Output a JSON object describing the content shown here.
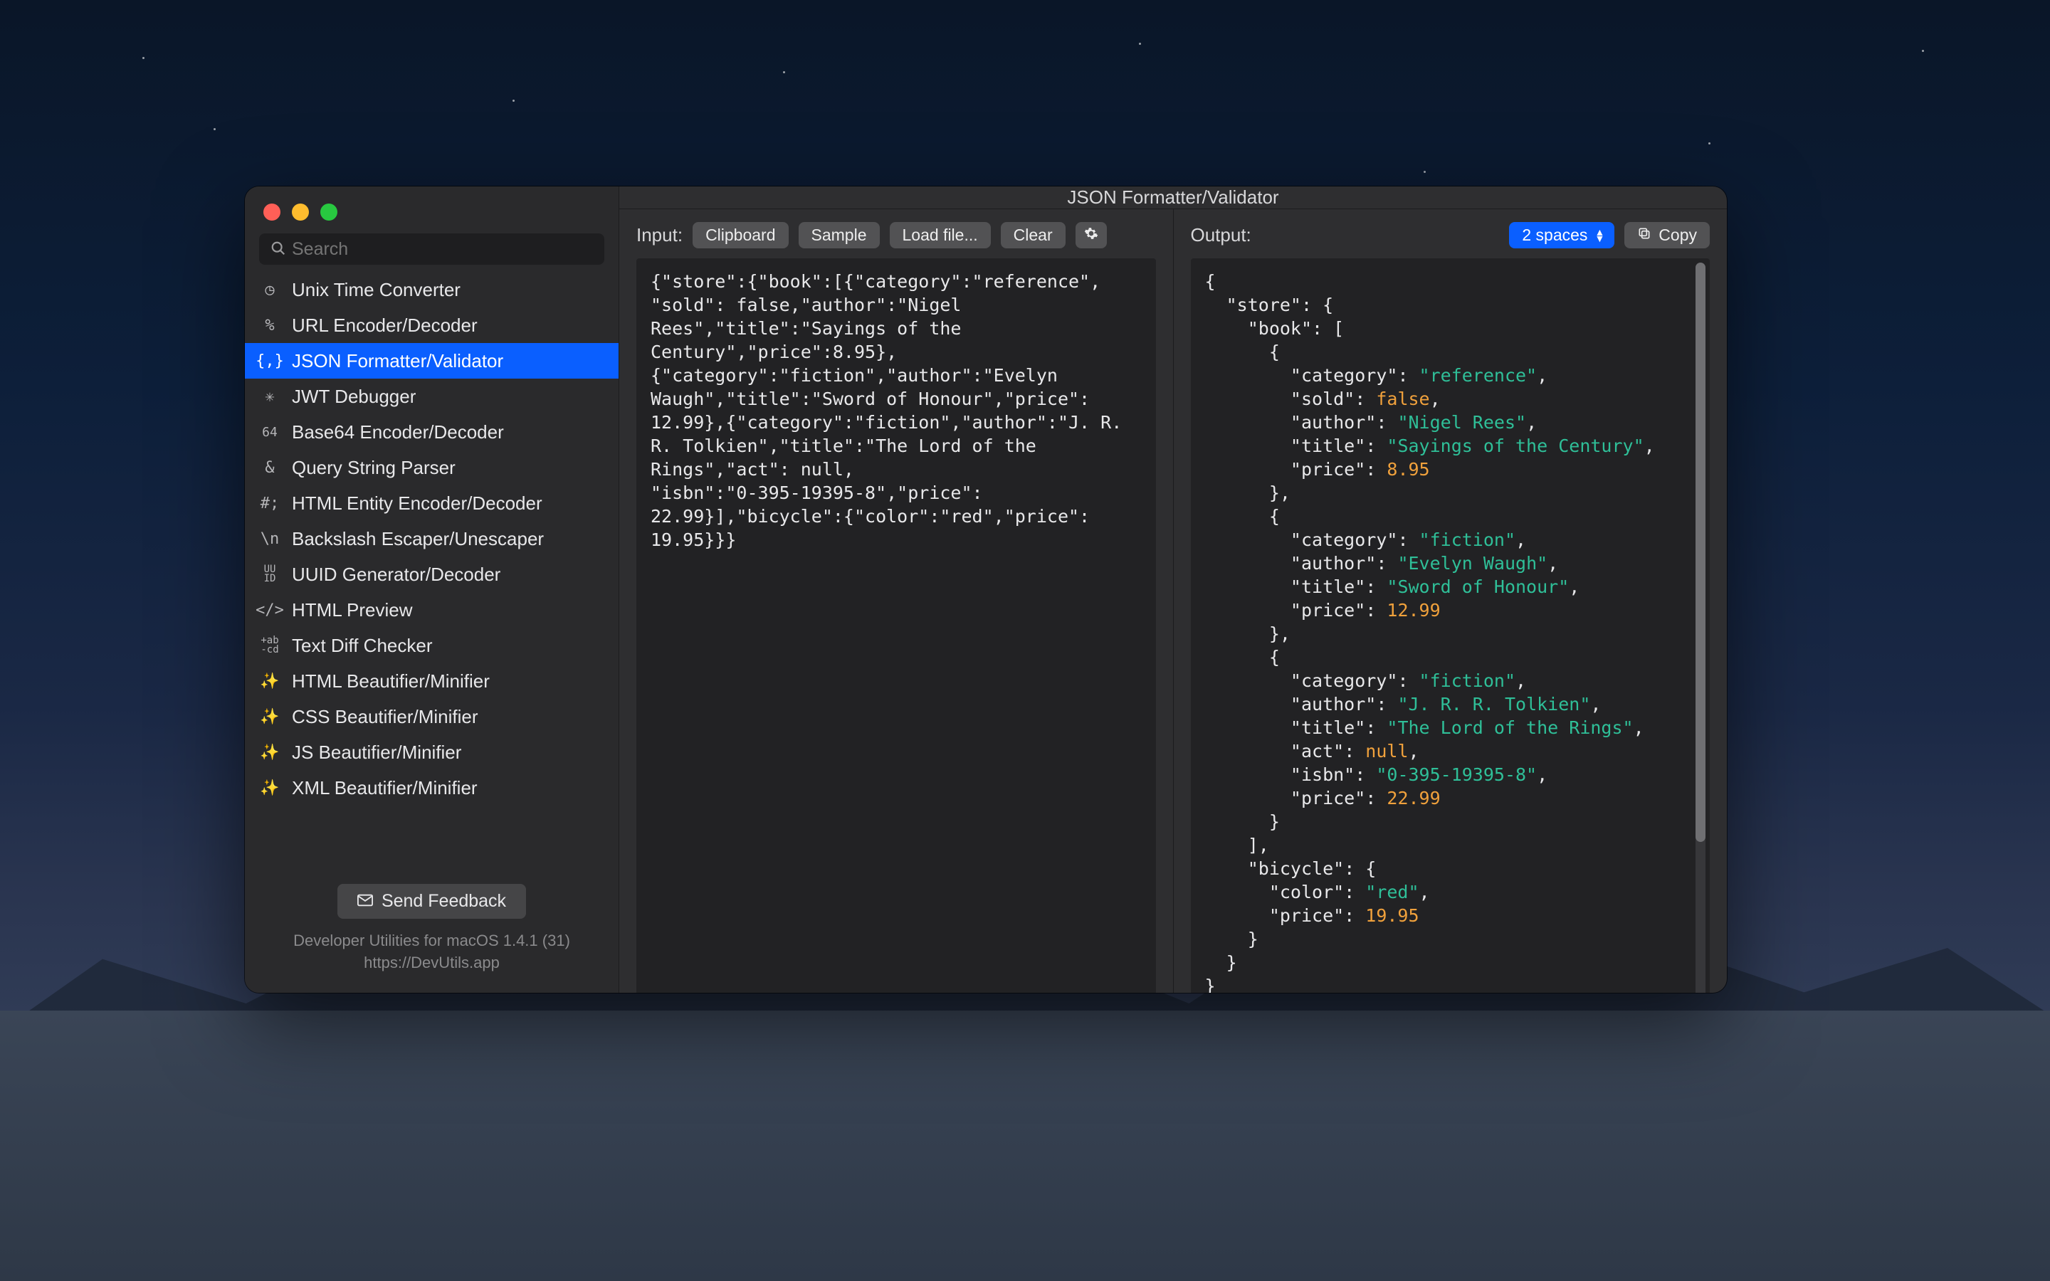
{
  "window": {
    "title": "JSON Formatter/Validator"
  },
  "search": {
    "placeholder": "Search"
  },
  "sidebar": {
    "items": [
      {
        "icon": "clock",
        "label": "Unix Time Converter"
      },
      {
        "icon": "percent",
        "label": "URL Encoder/Decoder"
      },
      {
        "icon": "braces",
        "label": "JSON Formatter/Validator",
        "selected": true
      },
      {
        "icon": "jwt",
        "label": "JWT Debugger"
      },
      {
        "icon": "b64",
        "label": "Base64 Encoder/Decoder"
      },
      {
        "icon": "amp",
        "label": "Query String Parser"
      },
      {
        "icon": "hash",
        "label": "HTML Entity Encoder/Decoder"
      },
      {
        "icon": "bsn",
        "label": "Backslash Escaper/Unescaper"
      },
      {
        "icon": "uuid",
        "label": "UUID Generator/Decoder"
      },
      {
        "icon": "code",
        "label": "HTML Preview"
      },
      {
        "icon": "diff",
        "label": "Text Diff Checker"
      },
      {
        "icon": "wand",
        "label": "HTML Beautifier/Minifier"
      },
      {
        "icon": "wand",
        "label": "CSS Beautifier/Minifier"
      },
      {
        "icon": "wand",
        "label": "JS Beautifier/Minifier"
      },
      {
        "icon": "wand",
        "label": "XML Beautifier/Minifier"
      }
    ]
  },
  "footer": {
    "feedback": "Send Feedback",
    "meta_line1": "Developer Utilities for macOS 1.4.1 (31)",
    "meta_line2": "https://DevUtils.app"
  },
  "input": {
    "label": "Input:",
    "buttons": {
      "clipboard": "Clipboard",
      "sample": "Sample",
      "load": "Load file...",
      "clear": "Clear"
    },
    "raw": "{\"store\":{\"book\":[{\"category\":\"reference\",\n\"sold\": false,\"author\":\"Nigel\nRees\",\"title\":\"Sayings of the\nCentury\",\"price\":8.95},\n{\"category\":\"fiction\",\"author\":\"Evelyn\nWaugh\",\"title\":\"Sword of Honour\",\"price\":\n12.99},{\"category\":\"fiction\",\"author\":\"J. R.\nR. Tolkien\",\"title\":\"The Lord of the\nRings\",\"act\": null,\n\"isbn\":\"0-395-19395-8\",\"price\":\n22.99}],\"bicycle\":{\"color\":\"red\",\"price\":\n19.95}}}"
  },
  "output": {
    "label": "Output:",
    "indent_select": "2 spaces",
    "copy": "Copy",
    "json": {
      "store": {
        "book": [
          {
            "category": "reference",
            "sold": false,
            "author": "Nigel Rees",
            "title": "Sayings of the Century",
            "price": 8.95
          },
          {
            "category": "fiction",
            "author": "Evelyn Waugh",
            "title": "Sword of Honour",
            "price": 12.99
          },
          {
            "category": "fiction",
            "author": "J. R. R. Tolkien",
            "title": "The Lord of the Rings",
            "act": null,
            "isbn": "0-395-19395-8",
            "price": 22.99
          }
        ],
        "bicycle": {
          "color": "red",
          "price": 19.95
        }
      }
    }
  }
}
